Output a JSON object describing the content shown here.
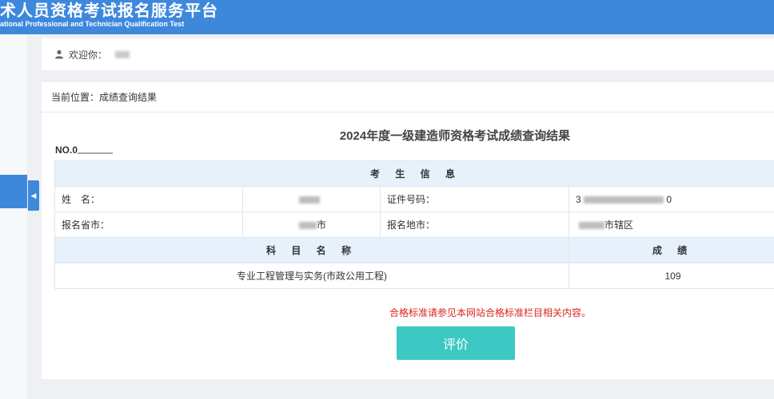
{
  "header": {
    "title_cn": "术人员资格考试报名服务平台",
    "title_en": "ational Professional and Technician Qualification Test"
  },
  "welcome": {
    "label": "欢迎你："
  },
  "breadcrumb": {
    "text": "当前位置：成绩查询结果"
  },
  "result": {
    "title": "2024年度一级建造师资格考试成绩查询结果",
    "serial_prefix": "NO.0"
  },
  "info": {
    "section_title": "考 生 信 息",
    "name_label": "姓　名：",
    "id_label": "证件号码：",
    "id_value_start": "3",
    "id_value_end": "0",
    "province_label": "报名省市：",
    "province_value_suffix": "市",
    "city_label": "报名地市：",
    "city_value_suffix": "市辖区"
  },
  "scores": {
    "subject_header": "科 目 名 称",
    "score_header": "成 绩",
    "rows": [
      {
        "subject": "专业工程管理与实务(市政公用工程)",
        "score": "109"
      }
    ]
  },
  "notice": "合格标准请参见本网站合格标准栏目相关内容。",
  "evaluate_button": "评价",
  "colors": {
    "header": "#3e88dc",
    "button": "#3cc9c4",
    "notice": "#d9251c",
    "table_head": "#e6f1fb"
  }
}
